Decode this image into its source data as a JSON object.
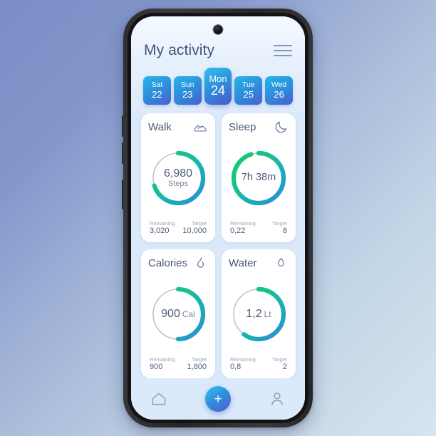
{
  "header": {
    "title": "My activity",
    "menu_icon": "hamburger-menu-icon"
  },
  "days": [
    {
      "dow": "Sat",
      "dom": "22",
      "selected": false
    },
    {
      "dow": "Sun",
      "dom": "23",
      "selected": false
    },
    {
      "dow": "Mon",
      "dom": "24",
      "selected": true
    },
    {
      "dow": "Tue",
      "dom": "25",
      "selected": false
    },
    {
      "dow": "Wed",
      "dom": "26",
      "selected": false
    }
  ],
  "cards": [
    {
      "title": "Walk",
      "icon": "sneaker-icon",
      "value": "6,980",
      "unit": "Steps",
      "remaining_label": "Remaining",
      "remaining_value": "3,020",
      "target_label": "Target",
      "target_value": "10,000",
      "progress_percent": 70
    },
    {
      "title": "Sleep",
      "icon": "moon-icon",
      "value": "7h 38m",
      "unit": "",
      "remaining_label": "Remaining",
      "remaining_value": "0,22",
      "target_label": "Target",
      "target_value": "8",
      "progress_percent": 95
    },
    {
      "title": "Calories",
      "icon": "flame-icon",
      "value": "900",
      "unit": "Cal",
      "remaining_label": "Remaining",
      "remaining_value": "900",
      "target_label": "Target",
      "target_value": "1,800",
      "progress_percent": 50
    },
    {
      "title": "Water",
      "icon": "water-drop-icon",
      "value": "1,2",
      "unit": "Lt",
      "remaining_label": "Remaining",
      "remaining_value": "0,8",
      "target_label": "Target",
      "target_value": "2",
      "progress_percent": 60
    }
  ],
  "bottom_nav": {
    "home_icon": "home-icon",
    "add_label": "+",
    "profile_icon": "user-profile-icon"
  },
  "colors": {
    "ring_start": "#16cf6a",
    "ring_mid": "#17b6a8",
    "ring_end": "#2b8ae0",
    "ring_track": "#b9c6d6",
    "chip_gradient_start": "#2fc0ee",
    "chip_gradient_end": "#4a57cf",
    "title_text": "#445579",
    "app_background": "#dbeafb"
  }
}
